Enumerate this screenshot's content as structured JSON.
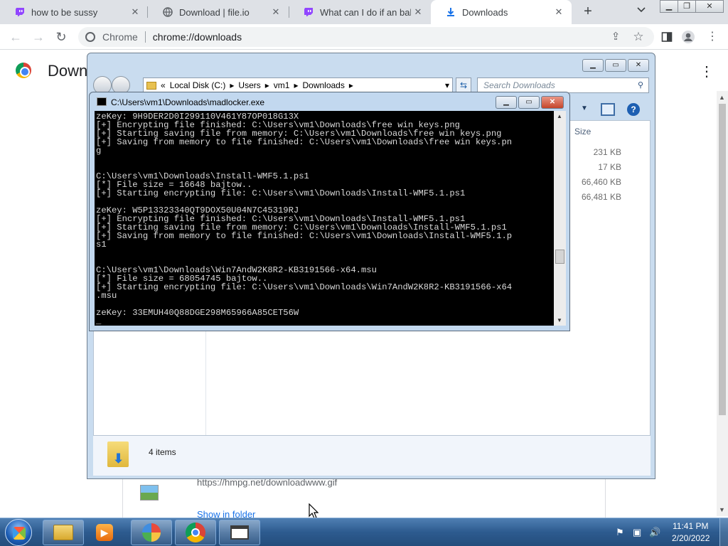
{
  "browser": {
    "tabs": [
      {
        "title": "how to be sussy",
        "icon": "twitch-icon"
      },
      {
        "title": "Download | file.io",
        "icon": "globe-icon"
      },
      {
        "title": "What can I do if an baka",
        "icon": "twitch-icon"
      },
      {
        "title": "Downloads",
        "icon": "download-icon",
        "active": true
      }
    ],
    "omnibox": {
      "chip": "Chrome",
      "url": "chrome://downloads"
    },
    "accent": "#1a73e8"
  },
  "downloads_page": {
    "title": "Downloads",
    "item": {
      "url": "https://hmpg.net/downloadwww.gif",
      "show_in_folder": "Show in folder"
    }
  },
  "explorer": {
    "breadcrumb": [
      "Local Disk (C:)",
      "Users",
      "vm1",
      "Downloads"
    ],
    "search_placeholder": "Search Downloads",
    "column_size": "Size",
    "sizes": [
      "231 KB",
      "17 KB",
      "66,460 KB",
      "66,481 KB"
    ],
    "status": "4 items"
  },
  "console": {
    "title": "C:\\Users\\vm1\\Downloads\\madlocker.exe",
    "lines": [
      "zeKey: 9H9DER2D0I299110V461Y87OP018G13X",
      "[+] Encrypting file finished: C:\\Users\\vm1\\Downloads\\free win keys.png",
      "[+] Starting saving file from memory: C:\\Users\\vm1\\Downloads\\free win keys.png",
      "[+] Saving from memory to file finished: C:\\Users\\vm1\\Downloads\\free win keys.pn",
      "g",
      "",
      "",
      "C:\\Users\\vm1\\Downloads\\Install-WMF5.1.ps1",
      "[*] File size = 16648 bajtow..",
      "[+] Starting encrypting file: C:\\Users\\vm1\\Downloads\\Install-WMF5.1.ps1",
      "",
      "zeKey: W5P13323340QT9DOX50U04N7C45319RJ",
      "[+] Encrypting file finished: C:\\Users\\vm1\\Downloads\\Install-WMF5.1.ps1",
      "[+] Starting saving file from memory: C:\\Users\\vm1\\Downloads\\Install-WMF5.1.ps1",
      "[+] Saving from memory to file finished: C:\\Users\\vm1\\Downloads\\Install-WMF5.1.p",
      "s1",
      "",
      "",
      "C:\\Users\\vm1\\Downloads\\Win7AndW2K8R2-KB3191566-x64.msu",
      "[*] File size = 68054745 bajtow..",
      "[+] Starting encrypting file: C:\\Users\\vm1\\Downloads\\Win7AndW2K8R2-KB3191566-x64",
      ".msu",
      "",
      "zeKey: 33EMUH40Q88DGE298M65966A85CET56W",
      "_"
    ]
  },
  "taskbar": {
    "apps": [
      "explorer-icon",
      "media-player-icon",
      "paint-icon",
      "chrome-icon",
      "console-icon"
    ],
    "time": "11:41 PM",
    "date": "2/20/2022"
  }
}
